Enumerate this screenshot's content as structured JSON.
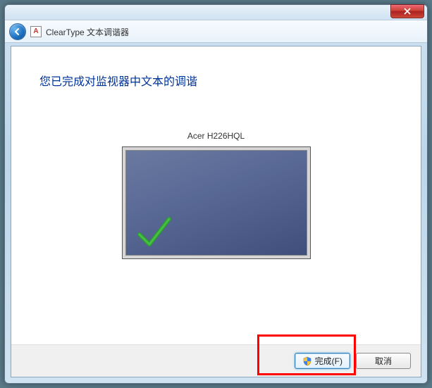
{
  "nav": {
    "title": "ClearType 文本调谐器",
    "icon_letter": "A"
  },
  "content": {
    "heading": "您已完成对监视器中文本的调谐",
    "monitor_name": "Acer H226HQL"
  },
  "footer": {
    "finish_label": "完成(F)",
    "cancel_label": "取消"
  }
}
